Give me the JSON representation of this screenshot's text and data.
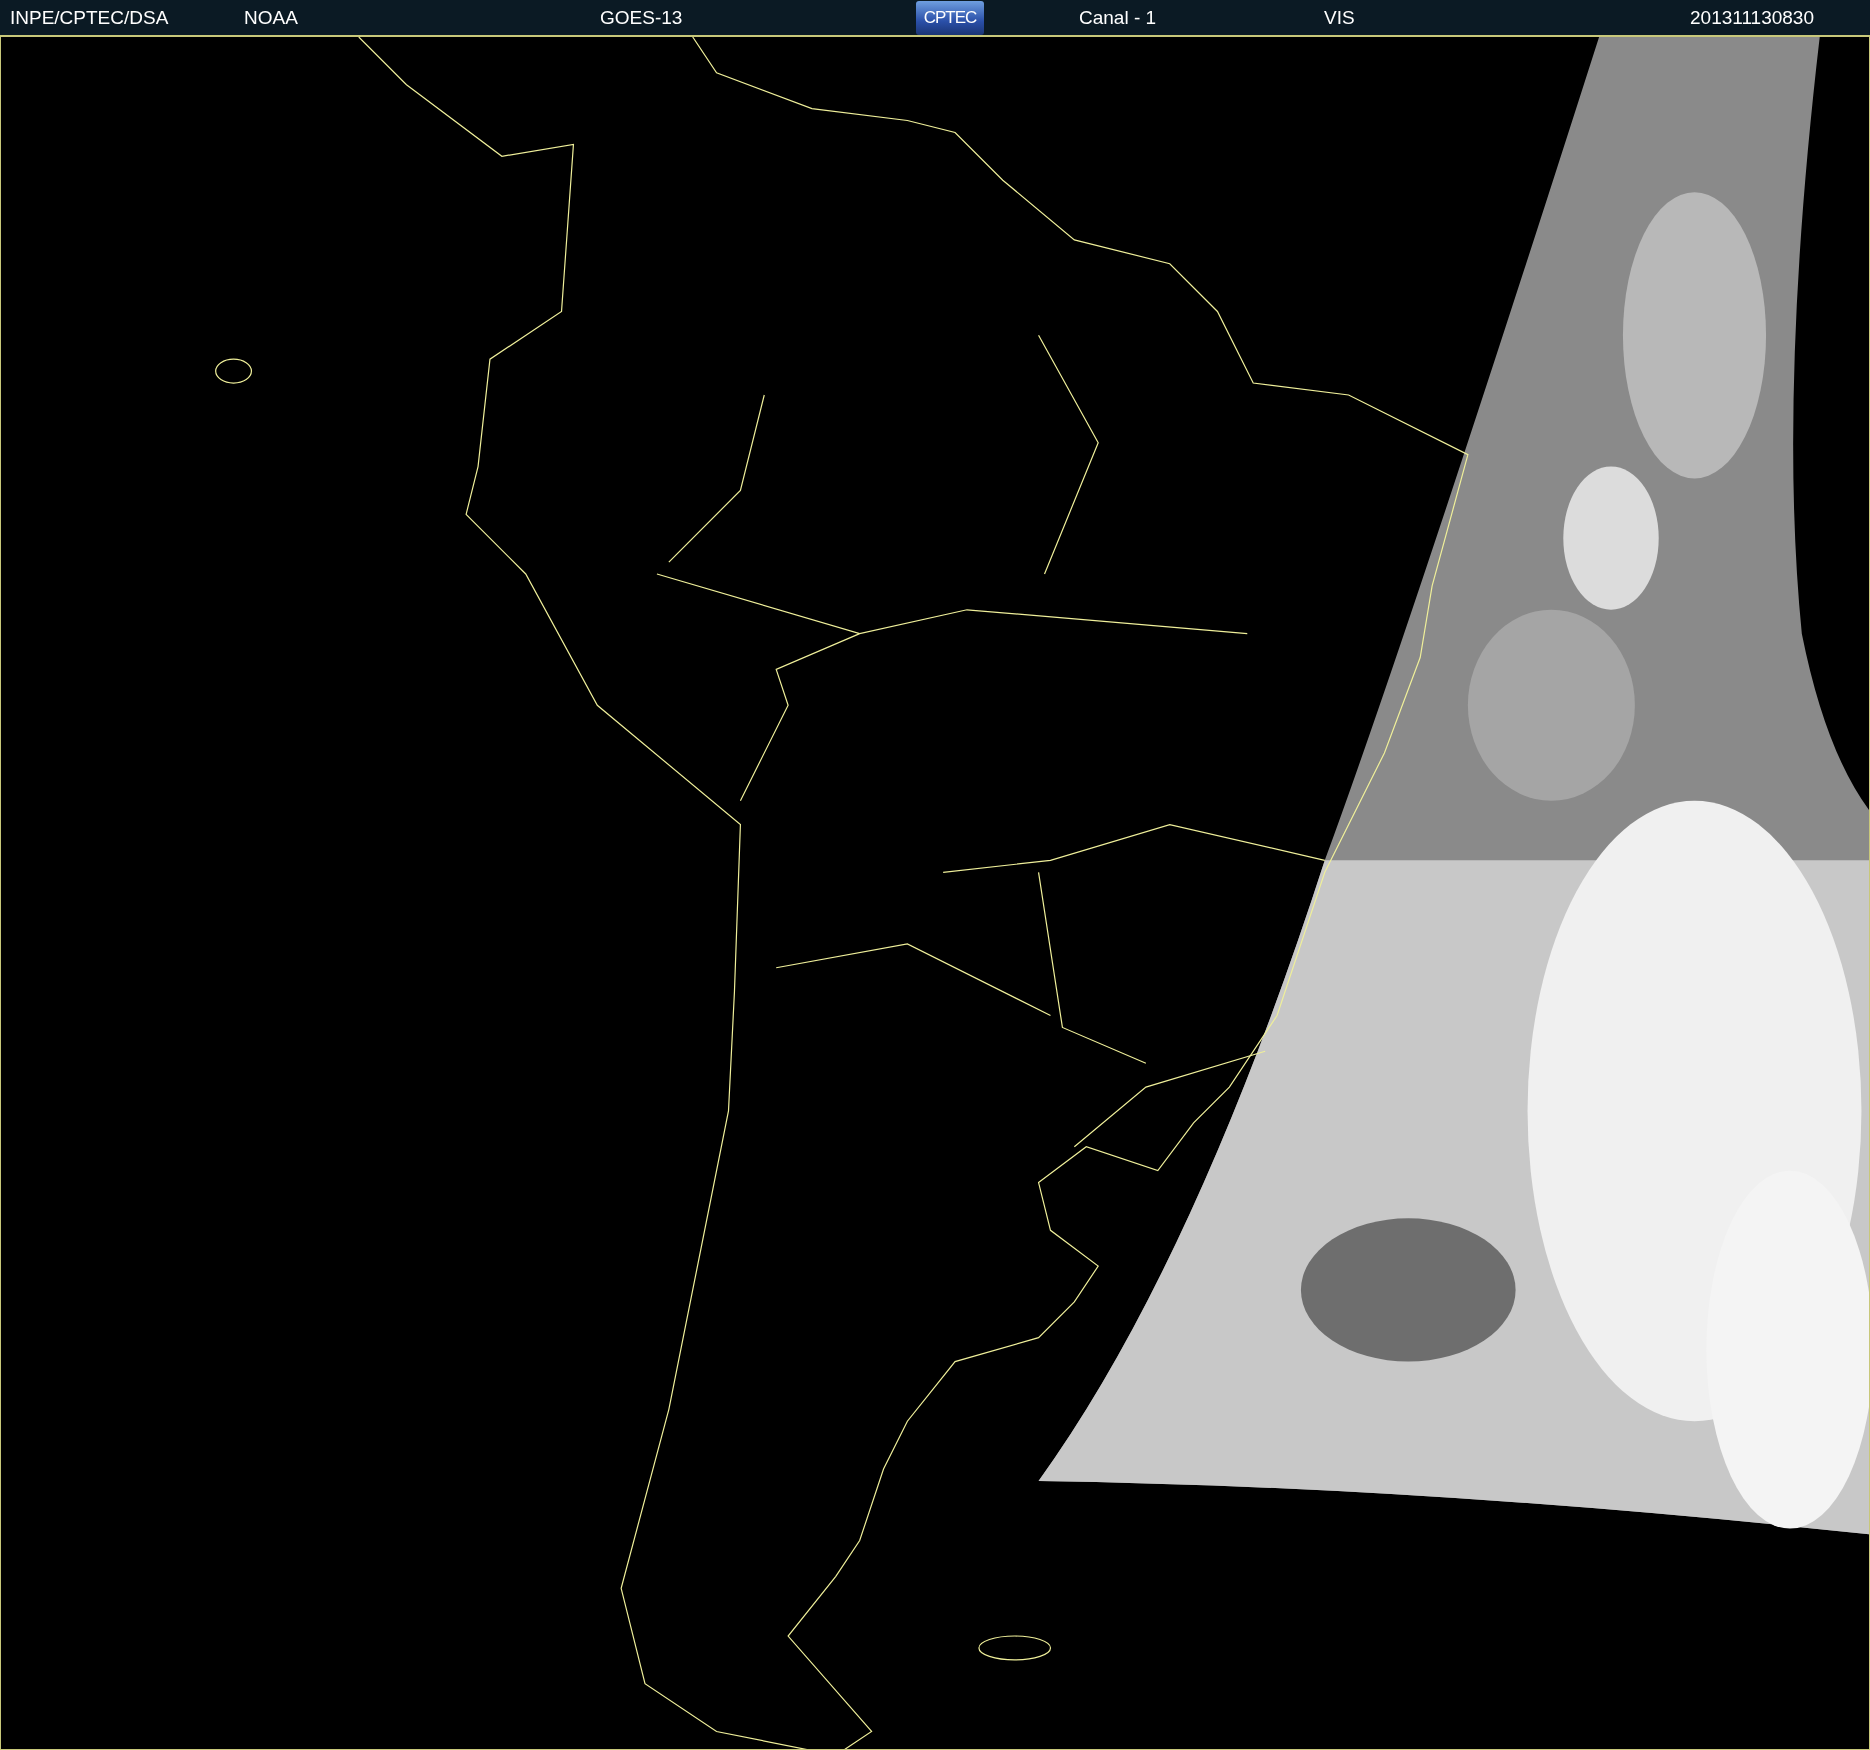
{
  "header": {
    "items": [
      {
        "kind": "text",
        "label": "INPE/CPTEC/DSA"
      },
      {
        "kind": "text",
        "label": "NOAA"
      },
      {
        "kind": "text",
        "label": "GOES-13"
      },
      {
        "kind": "logo",
        "label": "CPTEC"
      },
      {
        "kind": "text",
        "label": "Canal - 1"
      },
      {
        "kind": "text",
        "label": "VIS"
      },
      {
        "kind": "text",
        "label": "201311130830"
      }
    ]
  }
}
